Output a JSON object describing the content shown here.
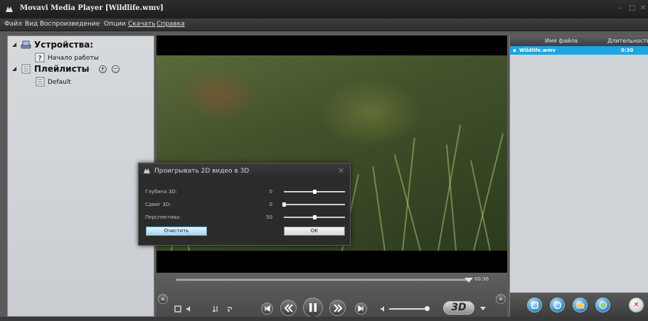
{
  "window": {
    "title": "Movavi Media Player [Wildlife.wmv]",
    "minimize_glyph": "–",
    "maximize_glyph": "□",
    "close_glyph": "✕"
  },
  "menu": {
    "file": "Файл",
    "view": "Вид",
    "playback": "Воспроизведение",
    "options": "Опции",
    "download": "Скачать",
    "help": "Справка"
  },
  "tree": {
    "devices_label": "Устройства:",
    "start_item": "Начало работы",
    "playlists_label": "Плейлисты",
    "add_glyph": "+",
    "remove_glyph": "−",
    "default_playlist": "Default",
    "expand_glyph": "◢"
  },
  "dialog": {
    "title": "Проигрывать 2D видео в 3D",
    "close_glyph": "✕",
    "depth_label": "Глубина 3D:",
    "depth_value": "0",
    "depth_level": 0.5,
    "shift_label": "Сдвиг 3D:",
    "shift_value": "0",
    "shift_level": 0.0,
    "perspective_label": "Перспектива:",
    "perspective_value": "50",
    "perspective_level": 0.5,
    "clear_button": "Очистить",
    "ok_button": "ОК"
  },
  "player": {
    "time": "00:36",
    "progress": 1.0,
    "badge_3d": "3D",
    "collapse_glyph": "«",
    "expand_glyph": "»",
    "icons": [
      "screen-icon",
      "volume-small-icon",
      "sort-icon",
      "repeat-icon",
      "skip-back-icon",
      "rewind-icon",
      "pause-icon",
      "forward-icon",
      "skip-forward-icon",
      "mute-icon",
      "volume-slider",
      "menu-arrow-icon"
    ]
  },
  "playlist": {
    "col_name": "Имя файла",
    "col_duration": "Длительность",
    "rows": [
      {
        "name": "Wildlife.wmv",
        "duration": "0:30"
      }
    ],
    "remove_glyph": "✕"
  },
  "colors": {
    "accent": "#1ea6e0",
    "dialog_bg": "#2b2b2b",
    "panel_bg": "#cfd2d6"
  }
}
